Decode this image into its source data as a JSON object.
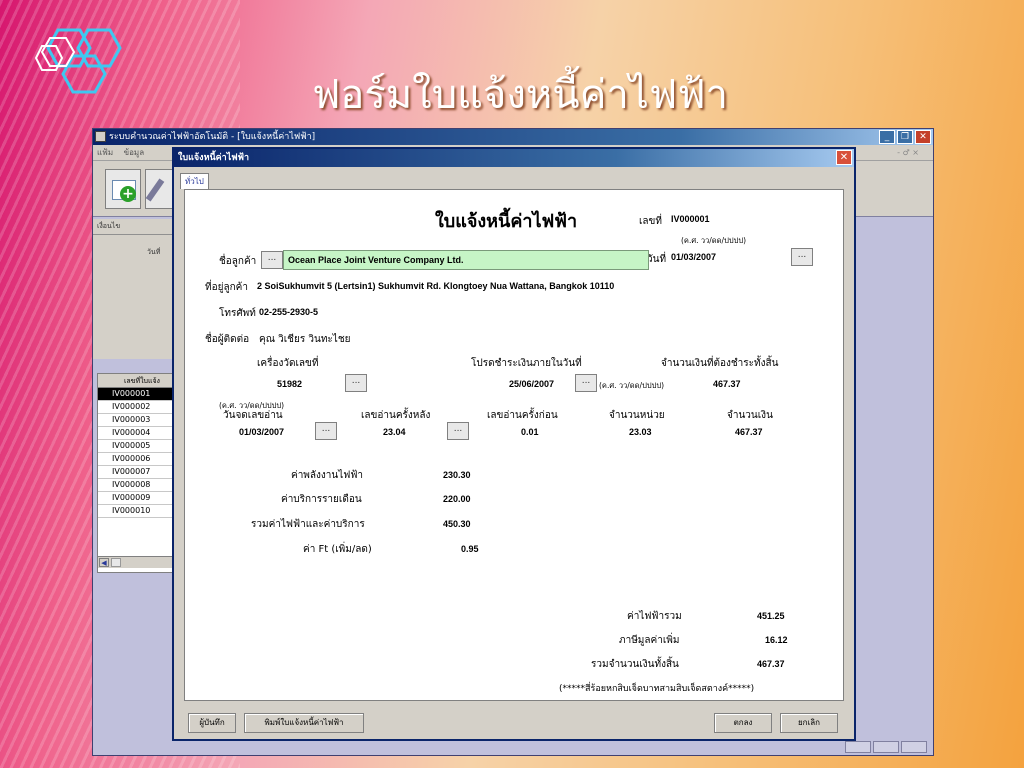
{
  "slide": {
    "title": "ฟอร์มใบแจ้งหนี้ค่าไฟฟ้า"
  },
  "app": {
    "window_title": "ระบบคำนวณค่าไฟฟ้าอัตโนมัติ - [ใบแจ้งหนี้ค่าไฟฟ้า]",
    "menu": [
      "แฟ้ม",
      "ข้อมูล"
    ],
    "mdi_controls": "- ♂ ×",
    "search_condition": "เงื่อนไข",
    "date_label": "วันที่",
    "list_header": "เลขที่ใบแจ้ง",
    "list_items": [
      "IV000001",
      "IV000002",
      "IV000003",
      "IV000004",
      "IV000005",
      "IV000006",
      "IV000007",
      "IV000008",
      "IV000009",
      "IV000010"
    ],
    "selected_item": "IV000001"
  },
  "dialog": {
    "title": "ใบแจ้งหนี้ค่าไฟฟ้า",
    "tab": "ทั่วไป",
    "form_title": "ใบแจ้งหนี้ค่าไฟฟ้า",
    "invoice_no_label": "เลขที่",
    "invoice_no": "IV000001",
    "date_format_hint": "(ค.ศ. วว/ดด/ปปปป)",
    "date_label": "วันที่",
    "date_value": "01/03/2007",
    "customer_label": "ชื่อลูกค้า",
    "customer_name": "Ocean Place Joint Venture Company Ltd.",
    "address_label": "ที่อยู่ลูกค้า",
    "address": "2 SoiSukhumvit 5 (Lertsin1) Sukhumvit Rd. Klongtoey Nua Wattana, Bangkok 10110",
    "phone_label": "โทรศัพท์",
    "phone": "02-255-2930-5",
    "contact_label": "ชื่อผู้ติดต่อ",
    "contact": "คุณ วิเชียร วินทะไชย",
    "meter_label": "เครื่องวัดเลขที่",
    "meter_no": "51982",
    "due_label": "โปรดชำระเงินภายในวันที่",
    "due_date": "25/06/2007",
    "due_hint": "(ค.ศ. วว/ดด/ปปปป)",
    "total_due_label": "จำนวนเงินที่ต้องชำระทั้งสิ้น",
    "total_due": "467.37",
    "read_date_hint": "(ค.ศ. วว/ดด/ปปปป)",
    "read_date_label": "วันจดเลขอ่าน",
    "read_date": "01/03/2007",
    "last_read_label": "เลขอ่านครั้งหลัง",
    "last_read": "23.04",
    "prev_read_label": "เลขอ่านครั้งก่อน",
    "prev_read": "0.01",
    "units_label": "จำนวนหน่วย",
    "units": "23.03",
    "amount_label": "จำนวนเงิน",
    "amount": "467.37",
    "energy_label": "ค่าพลังงานไฟฟ้า",
    "energy": "230.30",
    "service_label": "ค่าบริการรายเดือน",
    "service": "220.00",
    "subtotal_label": "รวมค่าไฟฟ้าและค่าบริการ",
    "subtotal": "450.30",
    "ft_label": "ค่า Ft (เพิ่ม/ลด)",
    "ft": "0.95",
    "elec_total_label": "ค่าไฟฟ้ารวม",
    "elec_total": "451.25",
    "vat_label": "ภาษีมูลค่าเพิ่ม",
    "vat": "16.12",
    "grand_total_label": "รวมจำนวนเงินทั้งสิ้น",
    "grand_total": "467.37",
    "amount_words": "(*****สี่ร้อยหกสิบเจ็ดบาทสามสิบเจ็ดสตางค์*****)",
    "dots": "...",
    "close_glyph": "✕",
    "buttons": {
      "save": "ผู้บันทึก",
      "print": "พิมพ์ใบแจ้งหนี้ค่าไฟฟ้า",
      "ok": "ตกลง",
      "cancel": "ยกเลิก"
    }
  }
}
